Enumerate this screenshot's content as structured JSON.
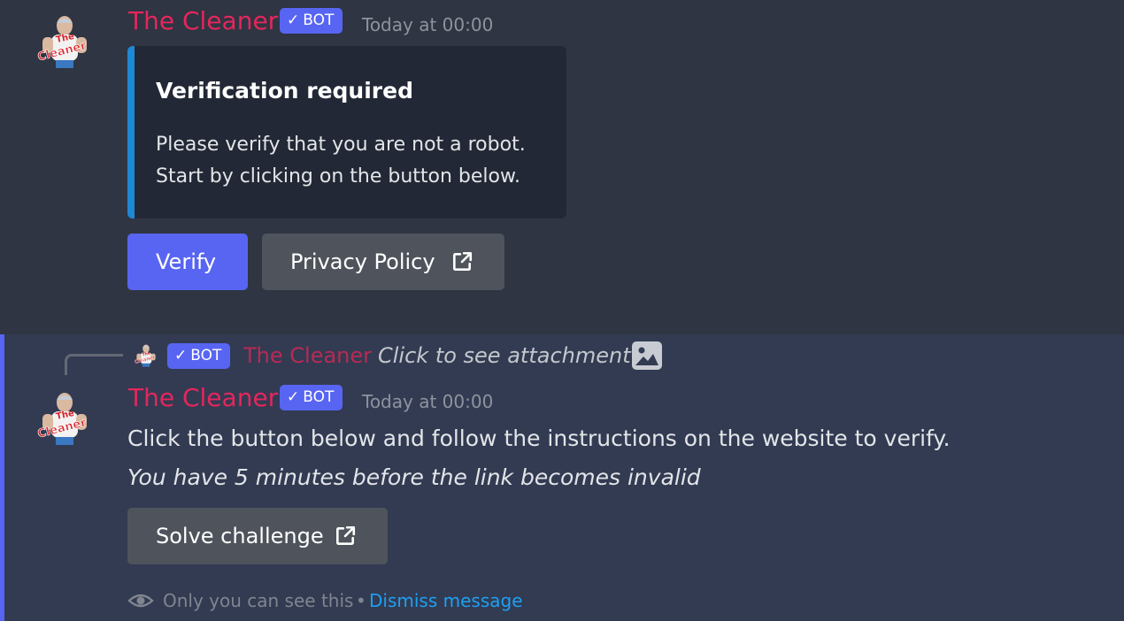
{
  "message1": {
    "author": "The Cleaner",
    "bot_tag": "BOT",
    "timestamp": "Today at 00:00",
    "avatar": "the-cleaner-avatar",
    "embed": {
      "title": "Verification required",
      "description_line1": "Please verify that you are not a robot.",
      "description_line2": "Start by clicking on the button below.",
      "accent_color": "#1e88d4"
    },
    "buttons": {
      "verify": "Verify",
      "privacy_policy": "Privacy Policy"
    }
  },
  "message2": {
    "reply": {
      "bot_tag": "BOT",
      "author": "The Cleaner",
      "text": "Click to see attachment",
      "icon": "image-icon"
    },
    "author": "The Cleaner",
    "bot_tag": "BOT",
    "timestamp": "Today at 00:00",
    "content_line1": "Click the button below and follow the instructions on the website to verify.",
    "content_line2": "You have 5 minutes before the link becomes invalid",
    "buttons": {
      "solve_challenge": "Solve challenge"
    },
    "ephemeral": {
      "note": "Only you can see this",
      "separator": "•",
      "dismiss": "Dismiss message"
    }
  },
  "colors": {
    "author": "#e5265c",
    "bot_tag": "#5865f2",
    "primary_button": "#5865f2",
    "secondary_button": "#4f545c",
    "link": "#1ea0f2",
    "highlight_border": "#5865f2"
  }
}
